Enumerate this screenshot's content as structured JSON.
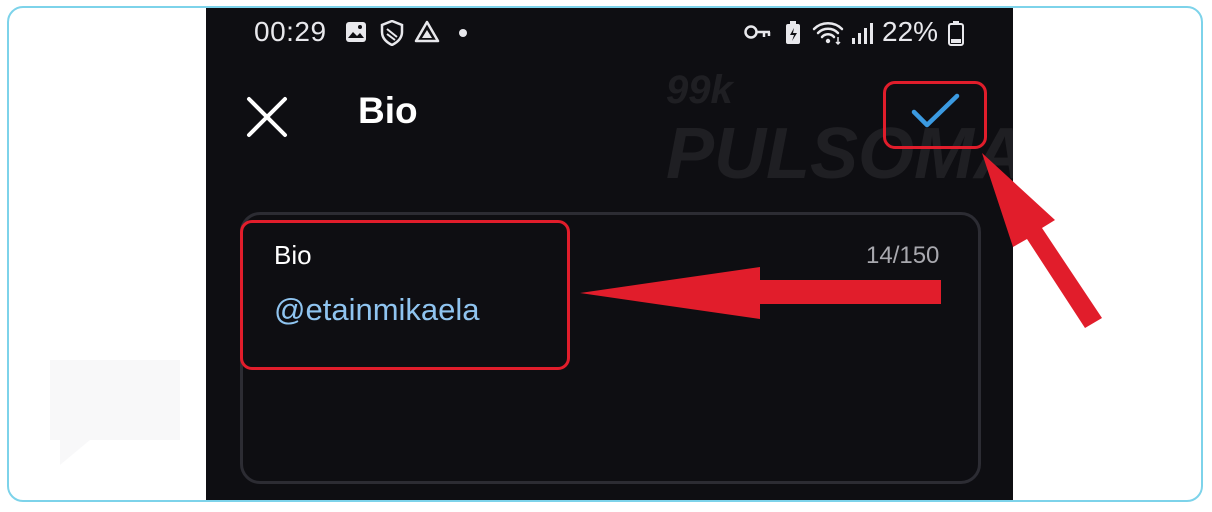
{
  "status_bar": {
    "time": "00:29",
    "battery_percent": "22%",
    "icons_left": [
      "image-icon",
      "shield-icon",
      "drive-icon",
      "dot-icon"
    ],
    "icons_right": [
      "key-icon",
      "battery-saver-icon",
      "wifi-icon",
      "signal-icon",
      "battery-icon"
    ]
  },
  "app_bar": {
    "title": "Bio",
    "close_icon": "close-icon",
    "confirm_icon": "check-icon",
    "confirm_color": "#3b9ae1"
  },
  "bio_field": {
    "label": "Bio",
    "counter": "14/150",
    "value": "@etainmikaela"
  },
  "watermark": {
    "text": "PULSOMAX",
    "badge": "99k"
  },
  "colors": {
    "annotation_red": "#e11d2b",
    "frame_border": "#7dd3ea",
    "background": "#0e0e12",
    "value_text": "#8fc4f0"
  }
}
